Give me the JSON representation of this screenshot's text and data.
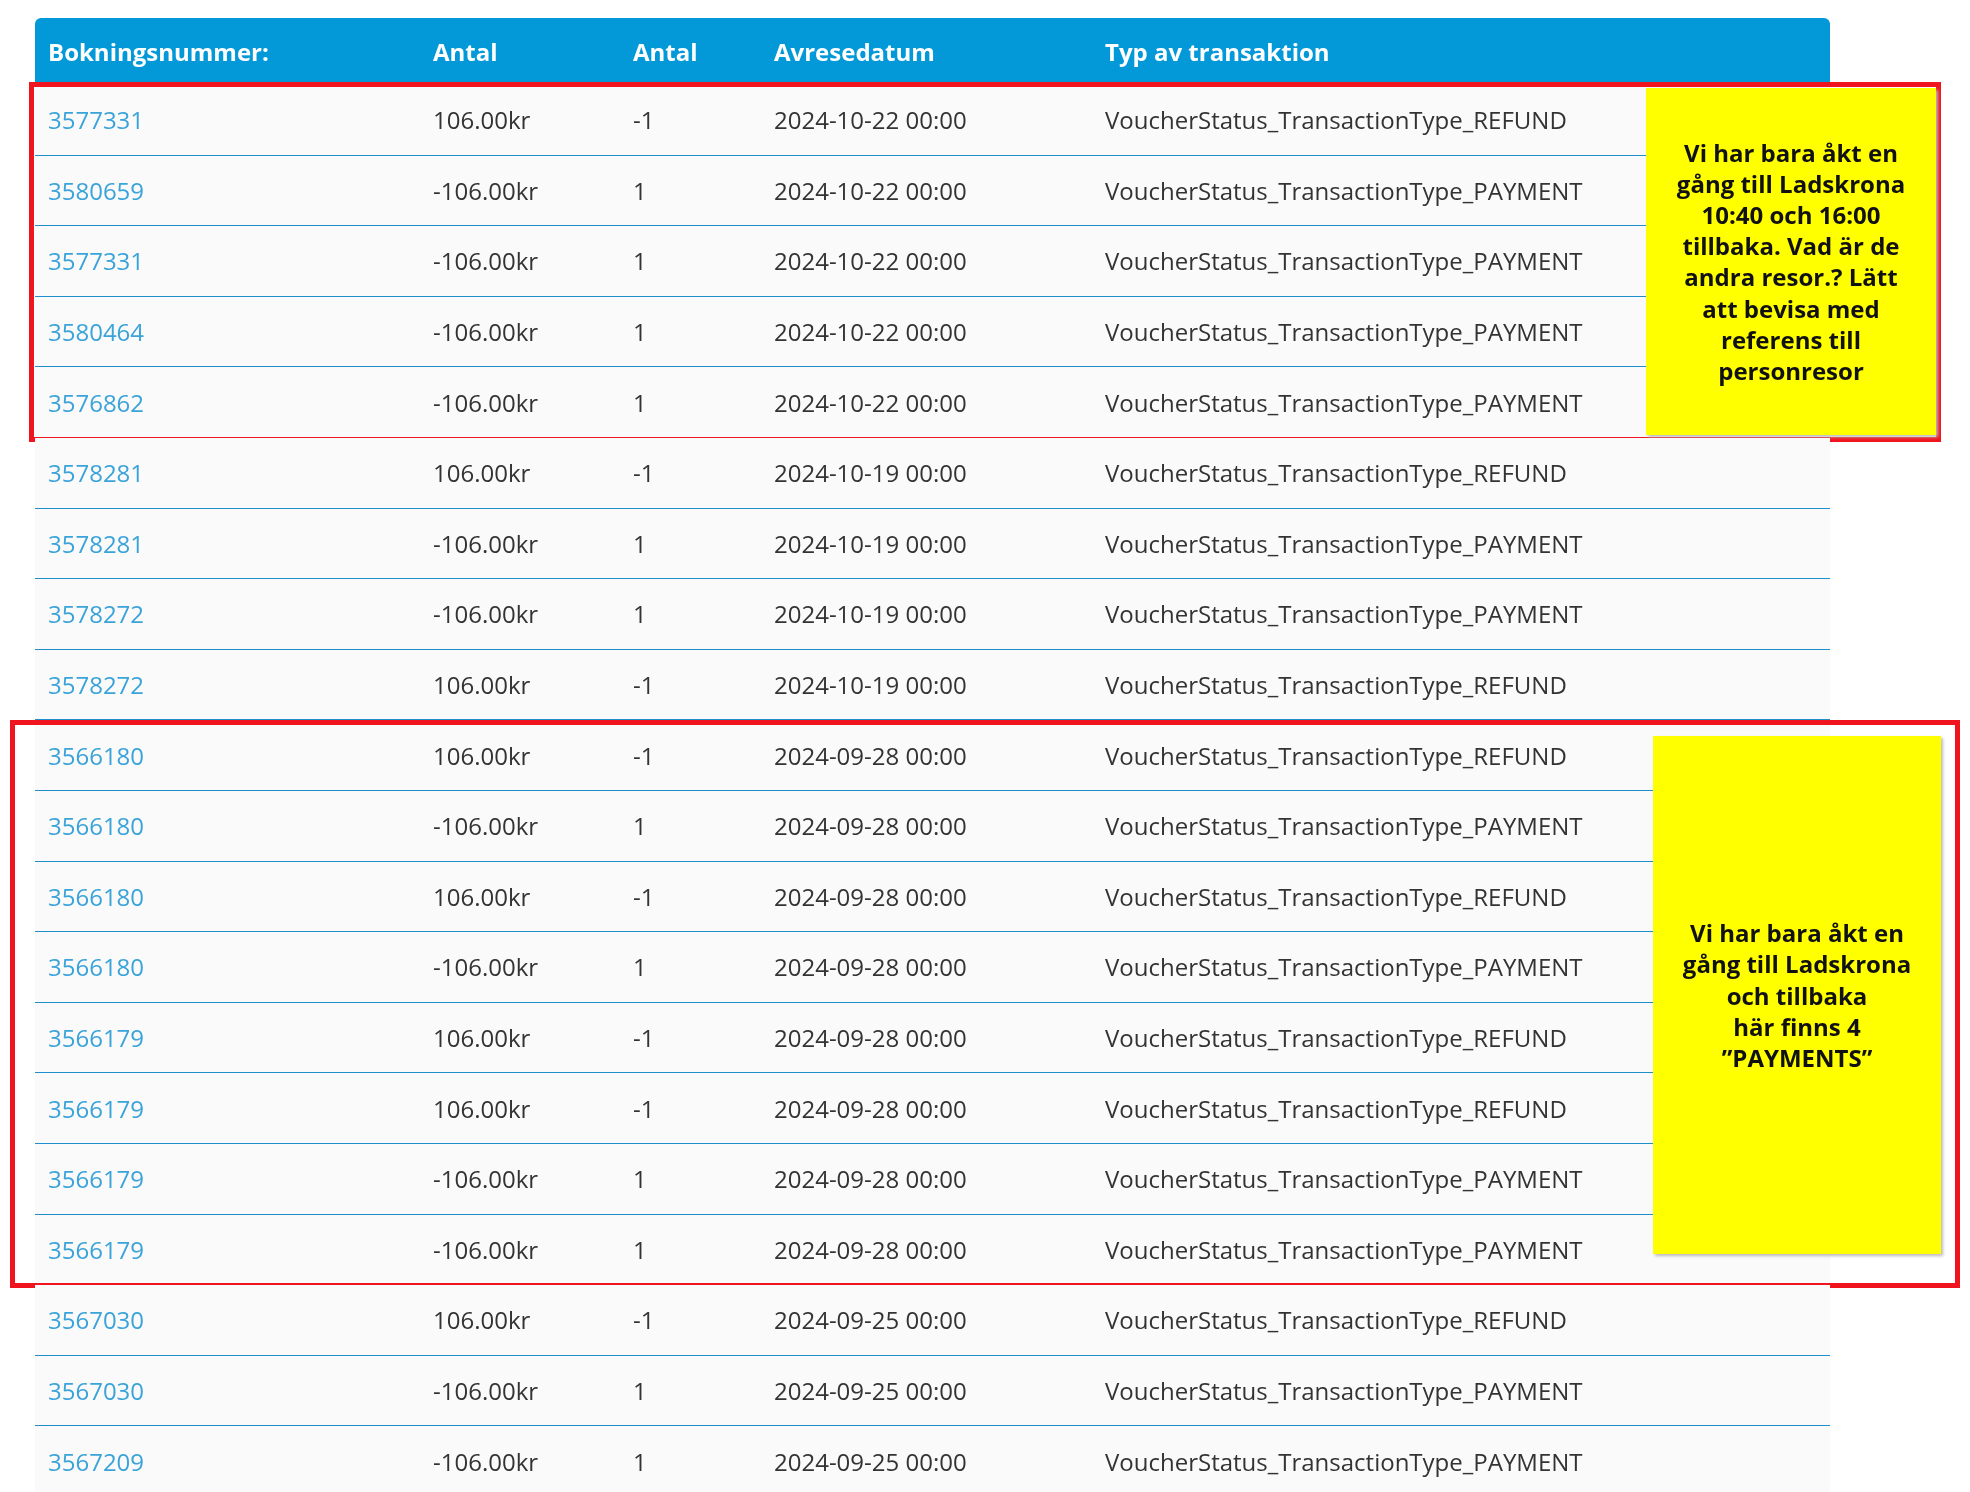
{
  "table": {
    "columns": [
      "Bokningsnummer:",
      "Antal",
      "Antal",
      "Avresedatum",
      "Typ av transaktion"
    ],
    "row_groups": [
      {
        "highlighted": true,
        "note": "Vi har bara åkt en\ngång till Ladskrona\n10:40  och 16:00\ntillbaka. Vad är de\nandra resor.? Lätt\natt bevisa med\nreferens till\npersonresor",
        "rows": [
          [
            "3577331",
            "106.00kr",
            "-1",
            "2024-10-22 00:00",
            "VoucherStatus_TransactionType_REFUND"
          ],
          [
            "3580659",
            "-106.00kr",
            "1",
            "2024-10-22 00:00",
            "VoucherStatus_TransactionType_PAYMENT"
          ],
          [
            "3577331",
            "-106.00kr",
            "1",
            "2024-10-22 00:00",
            "VoucherStatus_TransactionType_PAYMENT"
          ],
          [
            "3580464",
            "-106.00kr",
            "1",
            "2024-10-22 00:00",
            "VoucherStatus_TransactionType_PAYMENT"
          ],
          [
            "3576862",
            "-106.00kr",
            "1",
            "2024-10-22 00:00",
            "VoucherStatus_TransactionType_PAYMENT"
          ]
        ]
      },
      {
        "highlighted": false,
        "rows": [
          [
            "3578281",
            "106.00kr",
            "-1",
            "2024-10-19 00:00",
            "VoucherStatus_TransactionType_REFUND"
          ],
          [
            "3578281",
            "-106.00kr",
            "1",
            "2024-10-19 00:00",
            "VoucherStatus_TransactionType_PAYMENT"
          ],
          [
            "3578272",
            "-106.00kr",
            "1",
            "2024-10-19 00:00",
            "VoucherStatus_TransactionType_PAYMENT"
          ],
          [
            "3578272",
            "106.00kr",
            "-1",
            "2024-10-19 00:00",
            "VoucherStatus_TransactionType_REFUND"
          ]
        ]
      },
      {
        "highlighted": true,
        "note": "Vi har bara åkt en\ngång till Ladskrona\noch tillbaka\nhär finns 4\n”PAYMENTS”",
        "rows": [
          [
            "3566180",
            "106.00kr",
            "-1",
            "2024-09-28 00:00",
            "VoucherStatus_TransactionType_REFUND"
          ],
          [
            "3566180",
            "-106.00kr",
            "1",
            "2024-09-28 00:00",
            "VoucherStatus_TransactionType_PAYMENT"
          ],
          [
            "3566180",
            "106.00kr",
            "-1",
            "2024-09-28 00:00",
            "VoucherStatus_TransactionType_REFUND"
          ],
          [
            "3566180",
            "-106.00kr",
            "1",
            "2024-09-28 00:00",
            "VoucherStatus_TransactionType_PAYMENT"
          ],
          [
            "3566179",
            "106.00kr",
            "-1",
            "2024-09-28 00:00",
            "VoucherStatus_TransactionType_REFUND"
          ],
          [
            "3566179",
            "106.00kr",
            "-1",
            "2024-09-28 00:00",
            "VoucherStatus_TransactionType_REFUND"
          ],
          [
            "3566179",
            "-106.00kr",
            "1",
            "2024-09-28 00:00",
            "VoucherStatus_TransactionType_PAYMENT"
          ],
          [
            "3566179",
            "-106.00kr",
            "1",
            "2024-09-28 00:00",
            "VoucherStatus_TransactionType_PAYMENT"
          ]
        ]
      },
      {
        "highlighted": false,
        "rows": [
          [
            "3567030",
            "106.00kr",
            "-1",
            "2024-09-25 00:00",
            "VoucherStatus_TransactionType_REFUND"
          ],
          [
            "3567030",
            "-106.00kr",
            "1",
            "2024-09-25 00:00",
            "VoucherStatus_TransactionType_PAYMENT"
          ],
          [
            "3567209",
            "-106.00kr",
            "1",
            "2024-09-25 00:00",
            "VoucherStatus_TransactionType_PAYMENT"
          ]
        ]
      }
    ]
  }
}
